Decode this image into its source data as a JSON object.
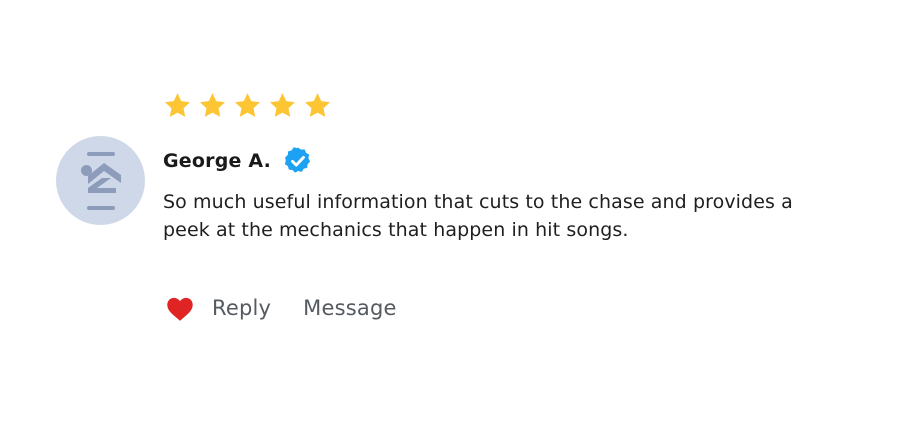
{
  "review": {
    "rating": 5,
    "rating_max": 5,
    "reviewer_name": "George A.",
    "text": "So much useful information that cuts to the chase and provides a peek at the mechanics that happen in hit songs."
  },
  "actions": {
    "like_icon": "heart-icon",
    "reply_label": "Reply",
    "message_label": "Message"
  },
  "icons": {
    "star": "star-icon",
    "verified": "verified-badge-icon",
    "avatar": "default-avatar-icon"
  },
  "colors": {
    "star": "#FDC534",
    "verified": "#1DA1F2",
    "heart": "#E02424",
    "avatar_bg": "#CED8E8",
    "avatar_fg": "#8C9CBA"
  }
}
